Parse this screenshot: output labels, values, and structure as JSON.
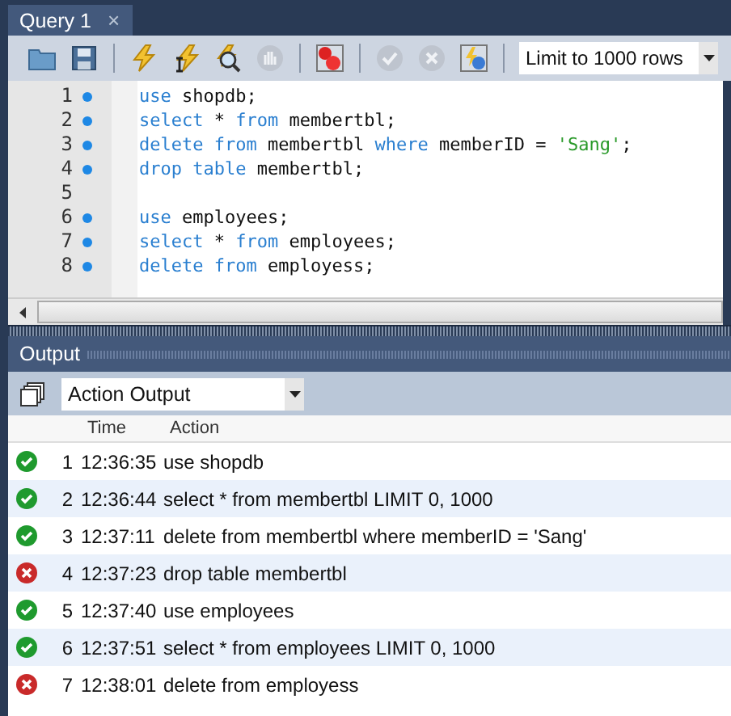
{
  "tabs": [
    {
      "label": "Query 1",
      "selected": true,
      "close": "×"
    }
  ],
  "toolbar": {
    "buttons": [
      {
        "kind": "folder",
        "disabled": false
      },
      {
        "kind": "save",
        "disabled": false
      },
      {
        "kind": "sep"
      },
      {
        "kind": "bolt",
        "disabled": false
      },
      {
        "kind": "bolt-cursor",
        "disabled": false
      },
      {
        "kind": "explain",
        "disabled": false
      },
      {
        "kind": "stop",
        "disabled": true
      },
      {
        "kind": "sep"
      },
      {
        "kind": "error-toggle",
        "disabled": false
      },
      {
        "kind": "sep"
      },
      {
        "kind": "commit",
        "disabled": true
      },
      {
        "kind": "rollback",
        "disabled": true
      },
      {
        "kind": "autocommit",
        "disabled": false
      },
      {
        "kind": "sep"
      }
    ],
    "limit": {
      "value": "Limit to 1000 rows"
    }
  },
  "editor": {
    "lines": [
      {
        "number": "1",
        "marker": true,
        "tokens": [
          {
            "kind": "keyword",
            "text": "use"
          },
          {
            "kind": "plain",
            "text": " shopdb;"
          }
        ]
      },
      {
        "number": "2",
        "marker": true,
        "tokens": [
          {
            "kind": "keyword",
            "text": "select"
          },
          {
            "kind": "plain",
            "text": " * "
          },
          {
            "kind": "keyword",
            "text": "from"
          },
          {
            "kind": "plain",
            "text": " membertbl;"
          }
        ]
      },
      {
        "number": "3",
        "marker": true,
        "tokens": [
          {
            "kind": "keyword",
            "text": "delete from"
          },
          {
            "kind": "plain",
            "text": " membertbl "
          },
          {
            "kind": "keyword",
            "text": "where"
          },
          {
            "kind": "plain",
            "text": " memberID = "
          },
          {
            "kind": "string",
            "text": "'Sang'"
          },
          {
            "kind": "plain",
            "text": ";"
          }
        ]
      },
      {
        "number": "4",
        "marker": true,
        "tokens": [
          {
            "kind": "keyword",
            "text": "drop table"
          },
          {
            "kind": "plain",
            "text": " membertbl;"
          }
        ]
      },
      {
        "number": "5",
        "marker": false
      },
      {
        "number": "6",
        "marker": true,
        "tokens": [
          {
            "kind": "keyword",
            "text": "use"
          },
          {
            "kind": "plain",
            "text": " employees;"
          }
        ]
      },
      {
        "number": "7",
        "marker": true,
        "tokens": [
          {
            "kind": "keyword",
            "text": "select"
          },
          {
            "kind": "plain",
            "text": " * "
          },
          {
            "kind": "keyword",
            "text": "from"
          },
          {
            "kind": "plain",
            "text": " employees;"
          }
        ]
      },
      {
        "number": "8",
        "marker": true,
        "tokens": [
          {
            "kind": "keyword",
            "text": "delete from"
          },
          {
            "kind": "plain",
            "text": " employess;"
          }
        ]
      }
    ]
  },
  "output": {
    "title": "Output",
    "selector": {
      "value": "Action Output"
    },
    "columns": [
      "Time",
      "Action"
    ],
    "rows": [
      {
        "kind": "success",
        "number": "1",
        "time": "12:36:35",
        "action": "use shopdb"
      },
      {
        "kind": "success",
        "number": "2",
        "time": "12:36:44",
        "action": "select * from membertbl LIMIT 0, 1000"
      },
      {
        "kind": "success",
        "number": "3",
        "time": "12:37:11",
        "action": "delete from membertbl where memberID = 'Sang'"
      },
      {
        "kind": "error",
        "number": "4",
        "time": "12:37:23",
        "action": "drop table membertbl"
      },
      {
        "kind": "success",
        "number": "5",
        "time": "12:37:40",
        "action": "use employees"
      },
      {
        "kind": "success",
        "number": "6",
        "time": "12:37:51",
        "action": "select * from employees LIMIT 0, 1000"
      },
      {
        "kind": "error",
        "number": "7",
        "time": "12:38:01",
        "action": "delete from employess"
      }
    ]
  }
}
